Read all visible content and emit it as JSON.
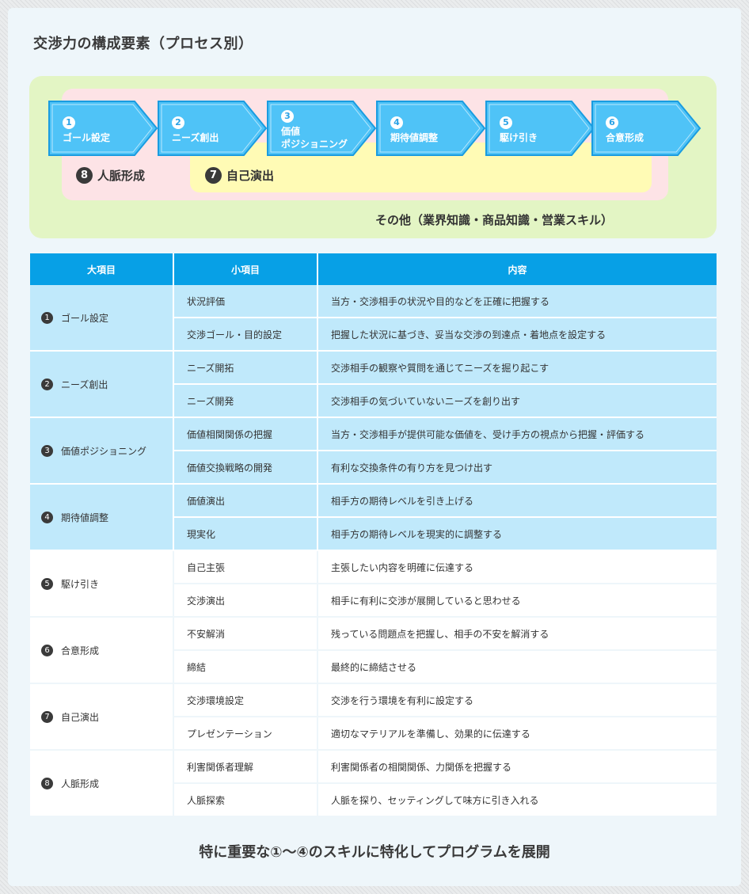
{
  "title": "交渉力の構成要素（プロセス別）",
  "diagram": {
    "steps": [
      {
        "num": "1",
        "line1": "ゴール設定",
        "line2": ""
      },
      {
        "num": "2",
        "line1": "ニーズ創出",
        "line2": ""
      },
      {
        "num": "3",
        "line1": "価値",
        "line2": "ポジショニング"
      },
      {
        "num": "4",
        "line1": "期待値調整",
        "line2": ""
      },
      {
        "num": "5",
        "line1": "駆け引き",
        "line2": ""
      },
      {
        "num": "6",
        "line1": "合意形成",
        "line2": ""
      }
    ],
    "zone8": {
      "num": "8",
      "label": "人脈形成"
    },
    "zone7": {
      "num": "7",
      "label": "自己演出"
    },
    "other_label": "その他（業界知識・商品知識・営業スキル）"
  },
  "table": {
    "headers": [
      "大項目",
      "小項目",
      "内容"
    ],
    "categories": [
      {
        "num": "1",
        "name": "ゴール設定",
        "rows": [
          {
            "sub": "状況評価",
            "content": "当方・交渉相手の状況や目的などを正確に把握する"
          },
          {
            "sub": "交渉ゴール・目的設定",
            "content": "把握した状況に基づき、妥当な交渉の到達点・着地点を設定する"
          }
        ]
      },
      {
        "num": "2",
        "name": "ニーズ創出",
        "rows": [
          {
            "sub": "ニーズ開拓",
            "content": "交渉相手の観察や質問を通じてニーズを掘り起こす"
          },
          {
            "sub": "ニーズ開発",
            "content": "交渉相手の気づいていないニーズを創り出す"
          }
        ]
      },
      {
        "num": "3",
        "name": "価値ポジショニング",
        "rows": [
          {
            "sub": "価値相関関係の把握",
            "content": "当方・交渉相手が提供可能な価値を、受け手方の視点から把握・評価する"
          },
          {
            "sub": "価値交換戦略の開発",
            "content": "有利な交換条件の有り方を見つけ出す"
          }
        ]
      },
      {
        "num": "4",
        "name": "期待値調整",
        "rows": [
          {
            "sub": "価値演出",
            "content": "相手方の期待レベルを引き上げる"
          },
          {
            "sub": "現実化",
            "content": "相手方の期待レベルを現実的に調整する"
          }
        ]
      },
      {
        "num": "5",
        "name": "駆け引き",
        "rows": [
          {
            "sub": "自己主張",
            "content": "主張したい内容を明確に伝達する"
          },
          {
            "sub": "交渉演出",
            "content": "相手に有利に交渉が展開していると思わせる"
          }
        ]
      },
      {
        "num": "6",
        "name": "合意形成",
        "rows": [
          {
            "sub": "不安解消",
            "content": "残っている問題点を把握し、相手の不安を解消する"
          },
          {
            "sub": "締結",
            "content": "最終的に締結させる"
          }
        ]
      },
      {
        "num": "7",
        "name": "自己演出",
        "rows": [
          {
            "sub": "交渉環境設定",
            "content": "交渉を行う環境を有利に設定する"
          },
          {
            "sub": "プレゼンテーション",
            "content": "適切なマテリアルを準備し、効果的に伝達する"
          }
        ]
      },
      {
        "num": "8",
        "name": "人脈形成",
        "rows": [
          {
            "sub": "利害関係者理解",
            "content": "利害関係者の相関関係、力関係を把握する"
          },
          {
            "sub": "人脈探索",
            "content": "人脈を探り、セッティングして味方に引き入れる"
          }
        ]
      }
    ]
  },
  "footer": "特に重要な①〜④のスキルに特化してプログラムを展開",
  "colors": {
    "header_blue": "#07a0e6",
    "highlight_row": "#c0e9fb",
    "step_fill": "#4fc3f7",
    "step_stroke": "#1a9ce0",
    "zone_other": "#e3f5c4",
    "zone_pink": "#fde3e6",
    "zone_yellow": "#fffbb5"
  }
}
